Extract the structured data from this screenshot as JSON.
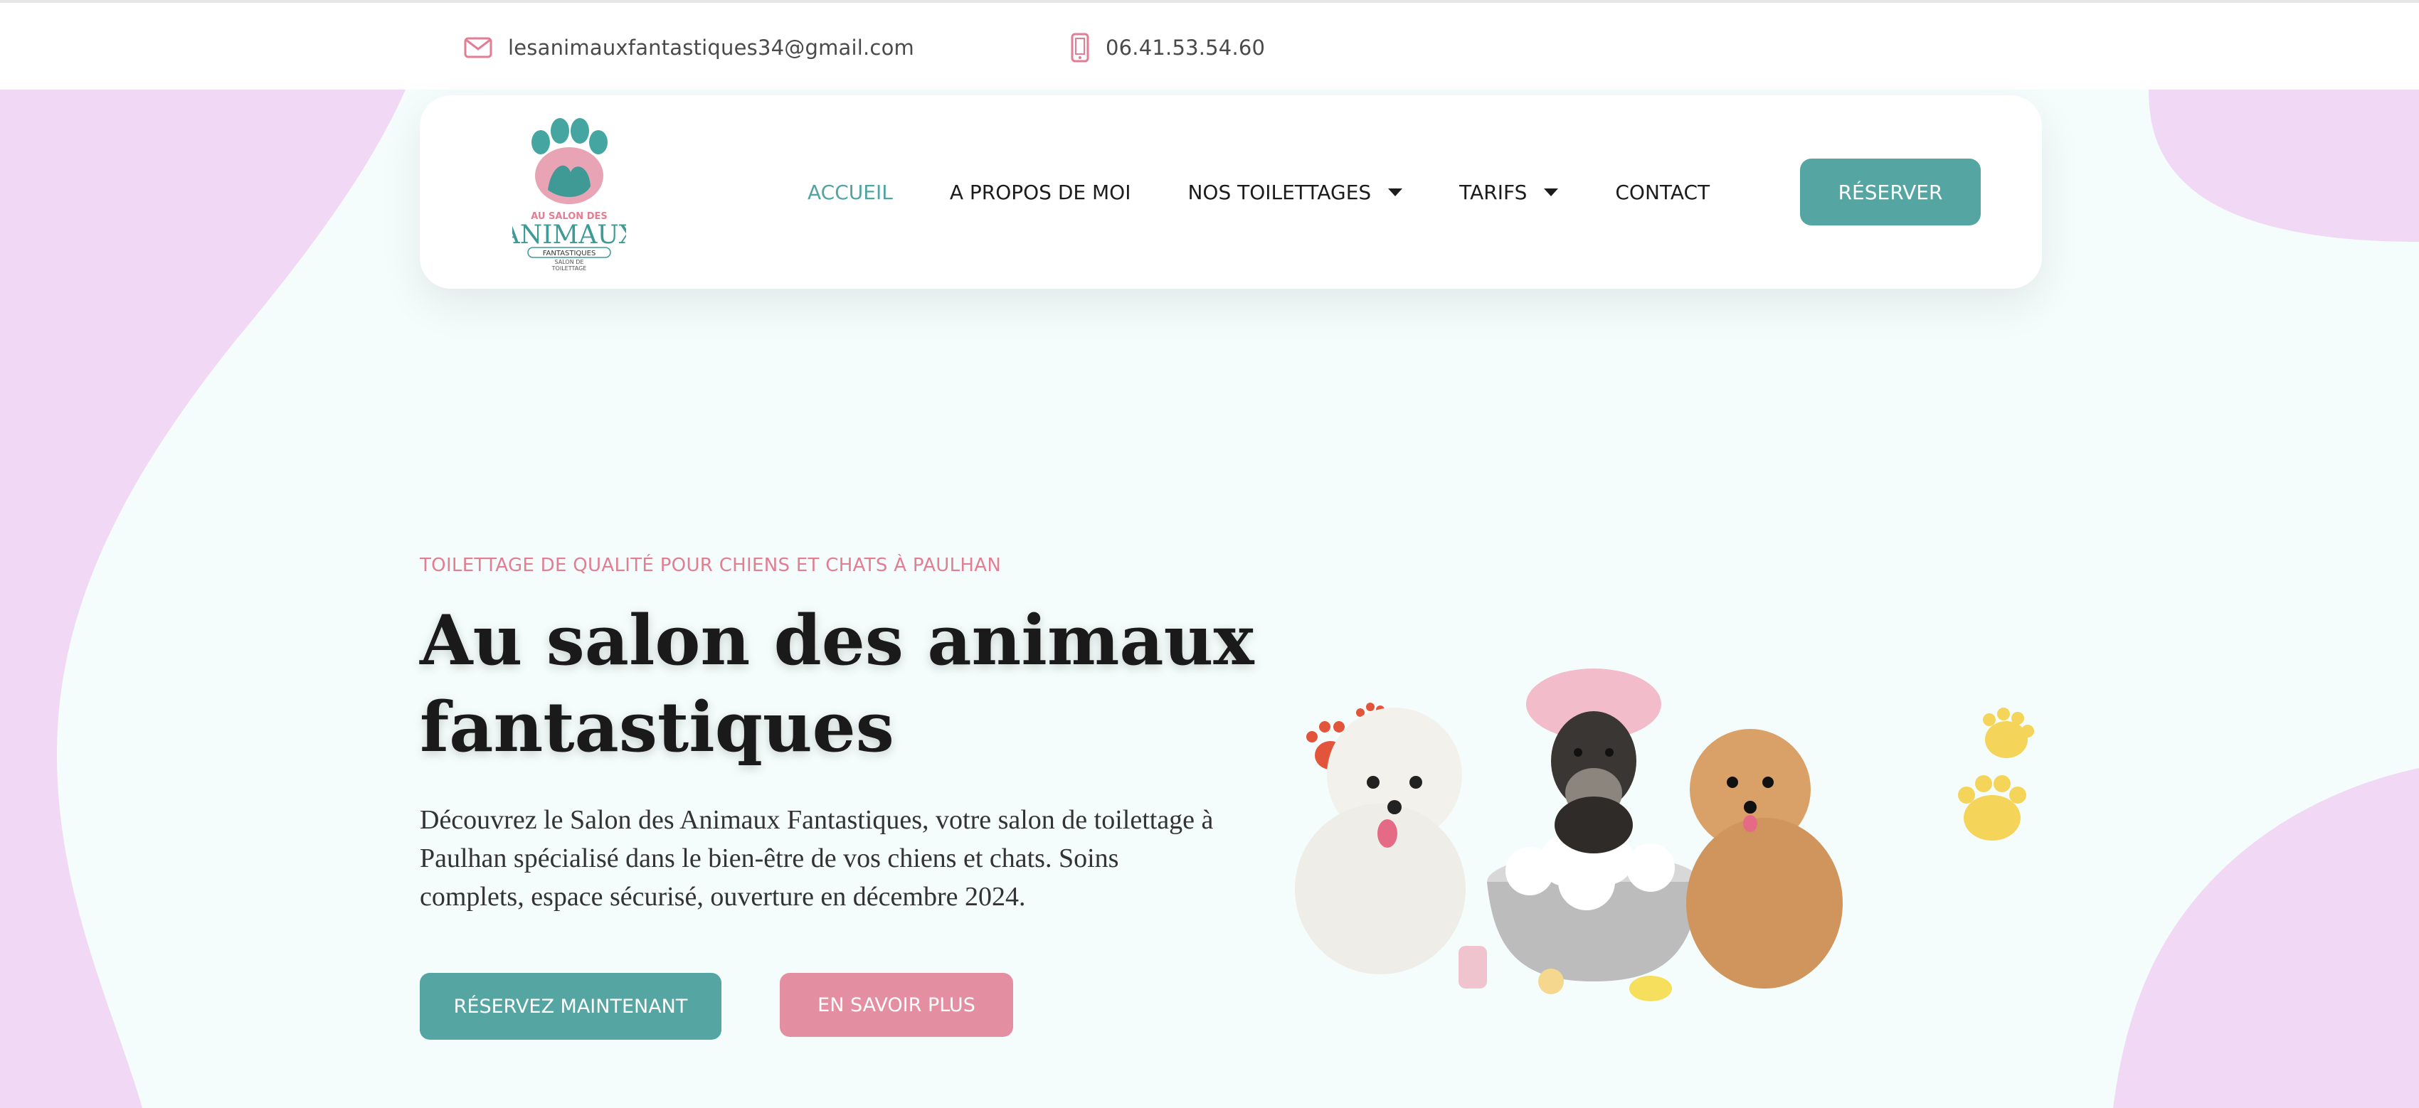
{
  "colors": {
    "accent_teal": "#55a6a3",
    "accent_pink": "#e48ea1",
    "eyebrow_pink": "#e27e94",
    "blob_lavender": "#f1d8f5",
    "page_bg": "#f4fdfb"
  },
  "topbar": {
    "email": "lesanimauxfantastiques34@gmail.com",
    "email_icon": "mail-icon",
    "phone": "06.41.53.54.60",
    "phone_icon": "phone-icon"
  },
  "header": {
    "logo": {
      "line1": "AU SALON DES",
      "line2": "ANIMAUX",
      "line3": "FANTASTIQUES",
      "line4": "SALON DE",
      "line5": "TOILETTAGE"
    },
    "nav": [
      {
        "label": "ACCUEIL",
        "active": true
      },
      {
        "label": "A PROPOS DE MOI"
      },
      {
        "label": "NOS TOILETTAGES",
        "dropdown": true
      },
      {
        "label": "TARIFS",
        "dropdown": true
      },
      {
        "label": "CONTACT"
      }
    ],
    "cta": "RÉSERVER"
  },
  "hero": {
    "eyebrow": "TOILETTAGE DE QUALITÉ POUR CHIENS ET CHATS À PAULHAN",
    "title_line1": "Au salon des animaux",
    "title_line2": "fantastiques",
    "description": "Découvrez le Salon des Animaux Fantastiques, votre salon de toilettage à Paulhan spécialisé dans le bien-être de vos chiens et chats. Soins complets, espace sécurisé, ouverture en décembre 2024.",
    "primary_button": "RÉSERVEZ MAINTENANT",
    "secondary_button": "EN SAVOIR PLUS"
  }
}
